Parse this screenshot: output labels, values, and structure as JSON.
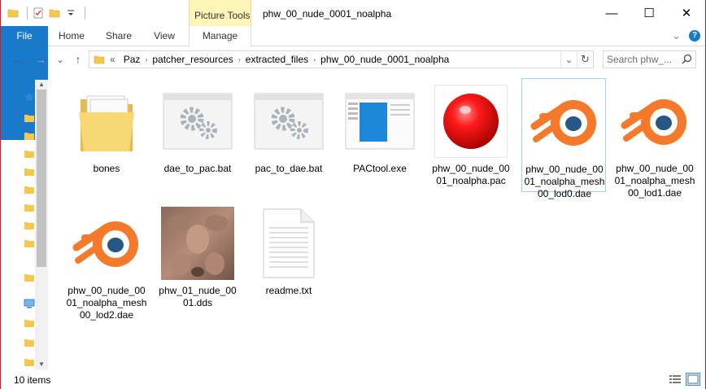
{
  "window": {
    "title": "phw_00_nude_0001_noalpha",
    "contextual_tab": "Picture Tools",
    "controls": {
      "minimize": "—",
      "maximize": "☐",
      "close": "✕"
    }
  },
  "ribbon": {
    "tabs": [
      {
        "label": "File"
      },
      {
        "label": "Home"
      },
      {
        "label": "Share"
      },
      {
        "label": "View"
      },
      {
        "label": "Manage"
      }
    ],
    "collapse_glyph": "⌄",
    "help_glyph": "?"
  },
  "nav": {
    "back": "←",
    "forward": "→",
    "recent": "⌄",
    "up": "↑"
  },
  "address": {
    "overflow": "«",
    "crumbs": [
      "Paz",
      "patcher_resources",
      "extracted_files",
      "phw_00_nude_0001_noalpha"
    ],
    "separator": "›",
    "dropdown": "⌄",
    "refresh": "↻"
  },
  "search": {
    "placeholder": "Search phw_..."
  },
  "files": [
    {
      "name": "bones",
      "type": "folder"
    },
    {
      "name": "dae_to_pac.bat",
      "type": "bat"
    },
    {
      "name": "pac_to_dae.bat",
      "type": "bat"
    },
    {
      "name": "PACtool.exe",
      "type": "exe"
    },
    {
      "name": "phw_00_nude_0001_noalpha.pac",
      "type": "pac"
    },
    {
      "name": "phw_00_nude_0001_noalpha_mesh00_lod0.dae",
      "type": "dae",
      "selected": true
    },
    {
      "name": "phw_00_nude_0001_noalpha_mesh00_lod1.dae",
      "type": "dae"
    },
    {
      "name": "phw_00_nude_0001_noalpha_mesh00_lod2.dae",
      "type": "dae"
    },
    {
      "name": "phw_01_nude_0001.dds",
      "type": "dds"
    },
    {
      "name": "readme.txt",
      "type": "txt"
    }
  ],
  "status": {
    "count": "10 items"
  },
  "colors": {
    "accent": "#1979ca",
    "window_border": "#e81123",
    "contextual_tab": "#fdf5b8",
    "selection_border": "#99d1ff",
    "blender_orange": "#f5792a",
    "blender_blue": "#265787"
  }
}
